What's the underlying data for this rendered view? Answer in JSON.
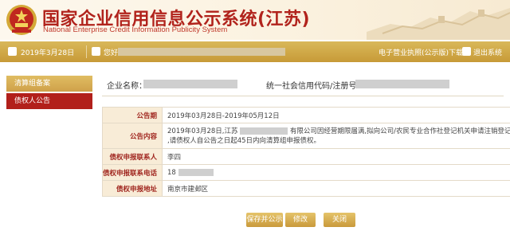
{
  "header": {
    "title": "国家企业信用信息公示系统(江苏)",
    "subtitle": "National Enterprise Credit Information Publicity System"
  },
  "topbar": {
    "date": "2019年3月28日",
    "greeting": "您好",
    "license_download": "电子营业执照(公示版)下载",
    "logout": "退出系统"
  },
  "sidebar": {
    "items": [
      {
        "label": "清算组备案"
      },
      {
        "label": "债权人公告"
      }
    ]
  },
  "company": {
    "name_label": "企业名称：",
    "credit_code_label": "统一社会信用代码/注册号："
  },
  "form": {
    "rows": [
      {
        "label": "公告期",
        "value": "2019年03月28日-2019年05月12日"
      },
      {
        "label": "公告内容",
        "line1_prefix": "2019年03月28日,江苏",
        "line1_suffix": "有限公司因经营期限届满,拟向公司/农民专业合作社登记机关申请注销登记",
        "line2": ",请债权人自公告之日起45日内向清算组申报债权。"
      },
      {
        "label": "债权申报联系人",
        "value": "李四"
      },
      {
        "label": "债权申报联系电话",
        "value": "18"
      },
      {
        "label": "债权申报地址",
        "value": "南京市建邺区"
      }
    ]
  },
  "buttons": {
    "save_publish": "保存并公示",
    "edit": "修改",
    "close": "关闭"
  },
  "colors": {
    "brand_red": "#b1231c",
    "gold": "#c79a37",
    "label_bg": "#f8ecd7"
  }
}
